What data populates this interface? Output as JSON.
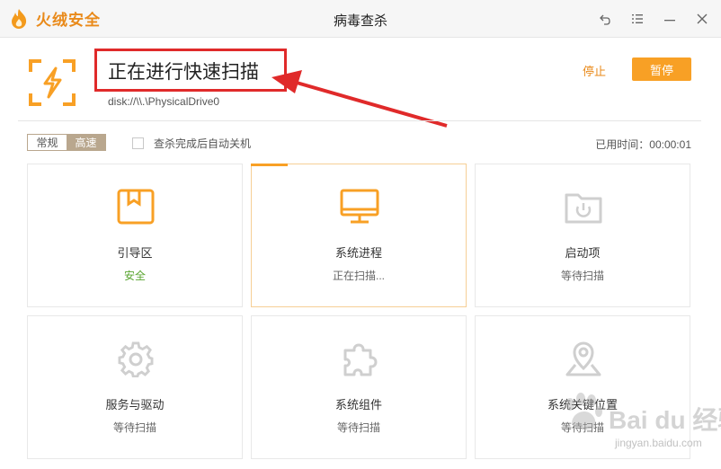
{
  "app": {
    "brand_name": "火绒安全",
    "window_title": "病毒查杀"
  },
  "header": {
    "status_title": "正在进行快速扫描",
    "disk_path": "disk://\\\\.\\PhysicalDrive0",
    "stop_label": "停止",
    "pause_label": "暂停"
  },
  "options": {
    "mode_normal": "常规",
    "mode_fast": "高速",
    "auto_shutdown_label": "查杀完成后自动关机",
    "elapsed_label": "已用时间：00:00:01"
  },
  "tiles": [
    {
      "name": "引导区",
      "status": "安全",
      "icon": "boot-sector-icon",
      "state": "safe"
    },
    {
      "name": "系统进程",
      "status": "正在扫描...",
      "icon": "monitor-icon",
      "state": "scanning"
    },
    {
      "name": "启动项",
      "status": "等待扫描",
      "icon": "startup-folder-icon",
      "state": "waiting"
    },
    {
      "name": "服务与驱动",
      "status": "等待扫描",
      "icon": "gear-icon",
      "state": "waiting"
    },
    {
      "name": "系统组件",
      "status": "等待扫描",
      "icon": "puzzle-icon",
      "state": "waiting"
    },
    {
      "name": "系统关键位置",
      "status": "等待扫描",
      "icon": "location-pin-icon",
      "state": "waiting"
    }
  ],
  "watermark": {
    "text": "Bai du 经验",
    "url": "jingyan.baidu.com"
  },
  "colors": {
    "accent": "#f8a025",
    "brand": "#e98a1a",
    "safe": "#5aa531",
    "annotation": "#e02a2a",
    "mode_active": "#b9a78e"
  }
}
